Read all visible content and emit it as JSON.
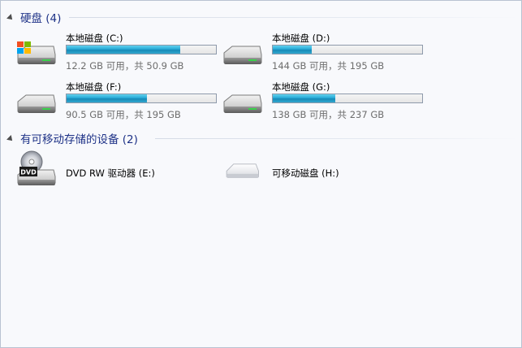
{
  "groups": [
    {
      "title": "硬盘 (4)"
    },
    {
      "title": "有可移动存储的设备 (2)"
    }
  ],
  "hard_drives": [
    {
      "name": "本地磁盘 (C:)",
      "info": "12.2 GB 可用，共 50.9 GB",
      "used_fraction": 0.76,
      "icon": "windows-drive-icon"
    },
    {
      "name": "本地磁盘 (D:)",
      "info": "144 GB 可用，共 195 GB",
      "used_fraction": 0.26,
      "icon": "hard-drive-icon"
    },
    {
      "name": "本地磁盘 (F:)",
      "info": "90.5 GB 可用，共 195 GB",
      "used_fraction": 0.54,
      "icon": "hard-drive-icon"
    },
    {
      "name": "本地磁盘 (G:)",
      "info": "138 GB 可用，共 237 GB",
      "used_fraction": 0.42,
      "icon": "hard-drive-icon"
    }
  ],
  "removable": [
    {
      "name": "DVD RW 驱动器 (E:)",
      "icon": "dvd-drive-icon",
      "icon_label": "DVD"
    },
    {
      "name": "可移动磁盘 (H:)",
      "icon": "removable-disk-icon"
    }
  ],
  "colors": {
    "header_text": "#1e3287",
    "bar_fill": "#27a9d6"
  }
}
